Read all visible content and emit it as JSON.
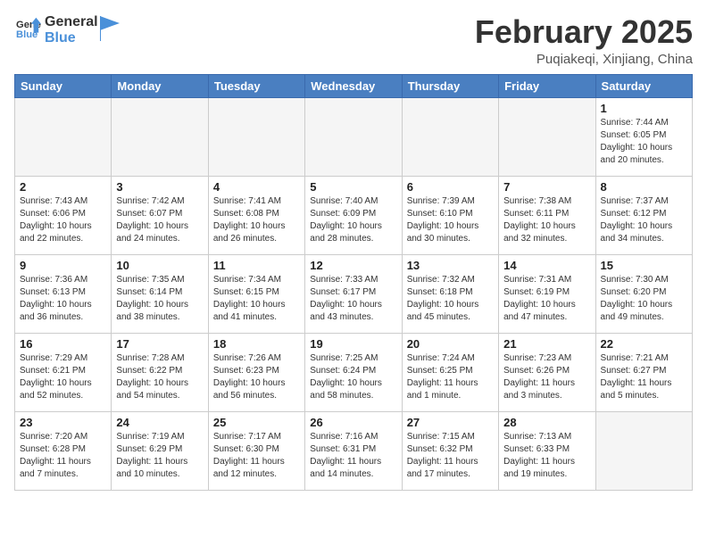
{
  "header": {
    "logo_line1": "General",
    "logo_line2": "Blue",
    "month": "February 2025",
    "location": "Puqiakeqi, Xinjiang, China"
  },
  "weekdays": [
    "Sunday",
    "Monday",
    "Tuesday",
    "Wednesday",
    "Thursday",
    "Friday",
    "Saturday"
  ],
  "weeks": [
    [
      {
        "day": "",
        "info": ""
      },
      {
        "day": "",
        "info": ""
      },
      {
        "day": "",
        "info": ""
      },
      {
        "day": "",
        "info": ""
      },
      {
        "day": "",
        "info": ""
      },
      {
        "day": "",
        "info": ""
      },
      {
        "day": "1",
        "info": "Sunrise: 7:44 AM\nSunset: 6:05 PM\nDaylight: 10 hours\nand 20 minutes."
      }
    ],
    [
      {
        "day": "2",
        "info": "Sunrise: 7:43 AM\nSunset: 6:06 PM\nDaylight: 10 hours\nand 22 minutes."
      },
      {
        "day": "3",
        "info": "Sunrise: 7:42 AM\nSunset: 6:07 PM\nDaylight: 10 hours\nand 24 minutes."
      },
      {
        "day": "4",
        "info": "Sunrise: 7:41 AM\nSunset: 6:08 PM\nDaylight: 10 hours\nand 26 minutes."
      },
      {
        "day": "5",
        "info": "Sunrise: 7:40 AM\nSunset: 6:09 PM\nDaylight: 10 hours\nand 28 minutes."
      },
      {
        "day": "6",
        "info": "Sunrise: 7:39 AM\nSunset: 6:10 PM\nDaylight: 10 hours\nand 30 minutes."
      },
      {
        "day": "7",
        "info": "Sunrise: 7:38 AM\nSunset: 6:11 PM\nDaylight: 10 hours\nand 32 minutes."
      },
      {
        "day": "8",
        "info": "Sunrise: 7:37 AM\nSunset: 6:12 PM\nDaylight: 10 hours\nand 34 minutes."
      }
    ],
    [
      {
        "day": "9",
        "info": "Sunrise: 7:36 AM\nSunset: 6:13 PM\nDaylight: 10 hours\nand 36 minutes."
      },
      {
        "day": "10",
        "info": "Sunrise: 7:35 AM\nSunset: 6:14 PM\nDaylight: 10 hours\nand 38 minutes."
      },
      {
        "day": "11",
        "info": "Sunrise: 7:34 AM\nSunset: 6:15 PM\nDaylight: 10 hours\nand 41 minutes."
      },
      {
        "day": "12",
        "info": "Sunrise: 7:33 AM\nSunset: 6:17 PM\nDaylight: 10 hours\nand 43 minutes."
      },
      {
        "day": "13",
        "info": "Sunrise: 7:32 AM\nSunset: 6:18 PM\nDaylight: 10 hours\nand 45 minutes."
      },
      {
        "day": "14",
        "info": "Sunrise: 7:31 AM\nSunset: 6:19 PM\nDaylight: 10 hours\nand 47 minutes."
      },
      {
        "day": "15",
        "info": "Sunrise: 7:30 AM\nSunset: 6:20 PM\nDaylight: 10 hours\nand 49 minutes."
      }
    ],
    [
      {
        "day": "16",
        "info": "Sunrise: 7:29 AM\nSunset: 6:21 PM\nDaylight: 10 hours\nand 52 minutes."
      },
      {
        "day": "17",
        "info": "Sunrise: 7:28 AM\nSunset: 6:22 PM\nDaylight: 10 hours\nand 54 minutes."
      },
      {
        "day": "18",
        "info": "Sunrise: 7:26 AM\nSunset: 6:23 PM\nDaylight: 10 hours\nand 56 minutes."
      },
      {
        "day": "19",
        "info": "Sunrise: 7:25 AM\nSunset: 6:24 PM\nDaylight: 10 hours\nand 58 minutes."
      },
      {
        "day": "20",
        "info": "Sunrise: 7:24 AM\nSunset: 6:25 PM\nDaylight: 11 hours\nand 1 minute."
      },
      {
        "day": "21",
        "info": "Sunrise: 7:23 AM\nSunset: 6:26 PM\nDaylight: 11 hours\nand 3 minutes."
      },
      {
        "day": "22",
        "info": "Sunrise: 7:21 AM\nSunset: 6:27 PM\nDaylight: 11 hours\nand 5 minutes."
      }
    ],
    [
      {
        "day": "23",
        "info": "Sunrise: 7:20 AM\nSunset: 6:28 PM\nDaylight: 11 hours\nand 7 minutes."
      },
      {
        "day": "24",
        "info": "Sunrise: 7:19 AM\nSunset: 6:29 PM\nDaylight: 11 hours\nand 10 minutes."
      },
      {
        "day": "25",
        "info": "Sunrise: 7:17 AM\nSunset: 6:30 PM\nDaylight: 11 hours\nand 12 minutes."
      },
      {
        "day": "26",
        "info": "Sunrise: 7:16 AM\nSunset: 6:31 PM\nDaylight: 11 hours\nand 14 minutes."
      },
      {
        "day": "27",
        "info": "Sunrise: 7:15 AM\nSunset: 6:32 PM\nDaylight: 11 hours\nand 17 minutes."
      },
      {
        "day": "28",
        "info": "Sunrise: 7:13 AM\nSunset: 6:33 PM\nDaylight: 11 hours\nand 19 minutes."
      },
      {
        "day": "",
        "info": ""
      }
    ]
  ]
}
